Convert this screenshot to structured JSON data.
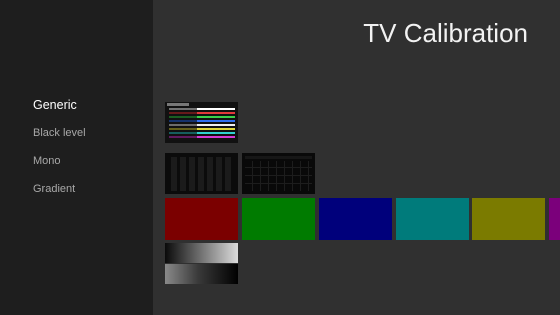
{
  "title": "TV Calibration",
  "nav": [
    {
      "label": "Generic",
      "selected": true
    },
    {
      "label": "Black level",
      "selected": false
    },
    {
      "label": "Mono",
      "selected": false
    },
    {
      "label": "Gradient",
      "selected": false
    }
  ],
  "colors": {
    "background": "#303030",
    "sidebar": "#1e1e1e",
    "selected_text": "#ffffff",
    "unselected_text": "#a8a8a8"
  },
  "bar_colors": [
    "#ffffff",
    "#e23a3a",
    "#3bd14a",
    "#3070f0",
    "#f0f0f0",
    "#e0d83a",
    "#2fd0d0",
    "#d53ad5"
  ],
  "mono_swatches": [
    {
      "name": "red",
      "color": "#7b0000"
    },
    {
      "name": "green",
      "color": "#007b00"
    },
    {
      "name": "blue",
      "color": "#00007b"
    },
    {
      "name": "cyan",
      "color": "#007b7b"
    },
    {
      "name": "yellow",
      "color": "#7b7b00"
    },
    {
      "name": "magenta",
      "color": "#7b007b"
    }
  ]
}
